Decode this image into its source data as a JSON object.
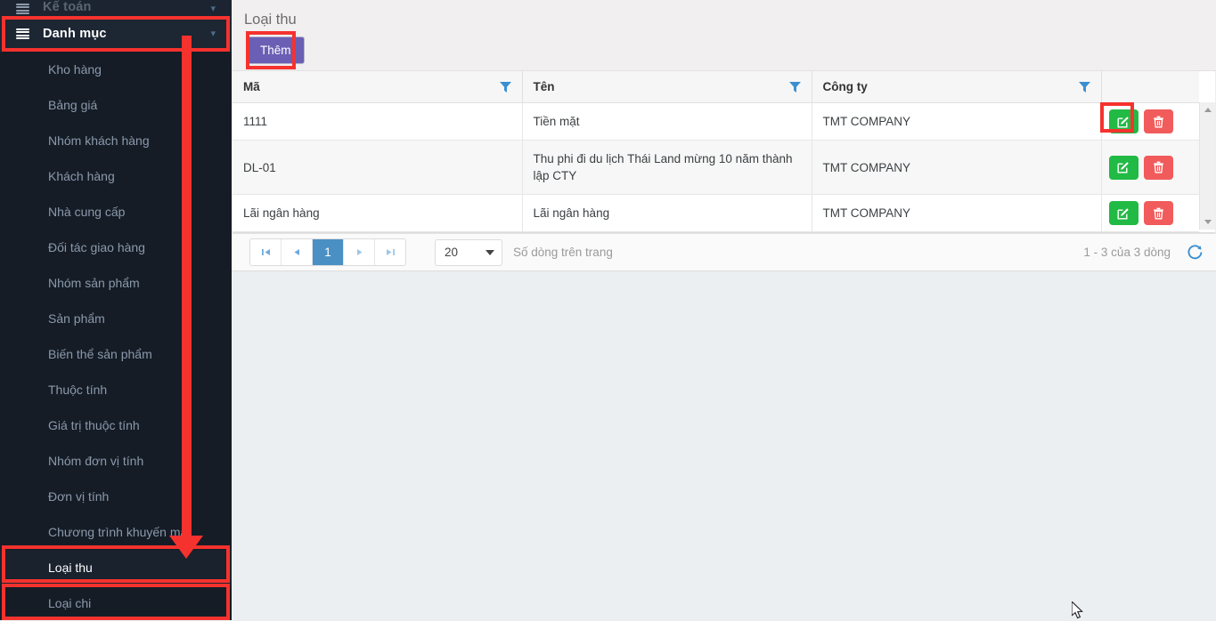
{
  "sidebar": {
    "group_partial": {
      "label": "Kế toán",
      "icon": "list-icon",
      "chevron": "chevron-down-icon"
    },
    "group_active": {
      "label": "Danh mục",
      "icon": "list-icon",
      "chevron": "chevron-down-icon"
    },
    "items": [
      {
        "label": "Kho hàng",
        "active": false
      },
      {
        "label": "Bảng giá",
        "active": false
      },
      {
        "label": "Nhóm khách hàng",
        "active": false
      },
      {
        "label": "Khách hàng",
        "active": false
      },
      {
        "label": "Nhà cung cấp",
        "active": false
      },
      {
        "label": "Đối tác giao hàng",
        "active": false
      },
      {
        "label": "Nhóm sản phẩm",
        "active": false
      },
      {
        "label": "Sản phẩm",
        "active": false
      },
      {
        "label": "Biến thể sản phẩm",
        "active": false
      },
      {
        "label": "Thuộc tính",
        "active": false
      },
      {
        "label": "Giá trị thuộc tính",
        "active": false
      },
      {
        "label": "Nhóm đơn vị tính",
        "active": false
      },
      {
        "label": "Đơn vị tính",
        "active": false
      },
      {
        "label": "Chương trình khuyến mại",
        "active": false
      },
      {
        "label": "Loại thu",
        "active": true
      },
      {
        "label": "Loại chi",
        "active": false
      }
    ]
  },
  "header": {
    "title": "Loại thu",
    "add_label": "Thêm"
  },
  "table": {
    "columns": [
      {
        "label": "Mã",
        "filter_icon": "filter-icon"
      },
      {
        "label": "Tên",
        "filter_icon": "filter-icon"
      },
      {
        "label": "Công ty",
        "filter_icon": "filter-icon"
      },
      {
        "label": "",
        "filter_icon": ""
      }
    ],
    "rows": [
      {
        "ma": "1111",
        "ten": "Tiền mặt",
        "congty": "TMT COMPANY",
        "edit_icon": "edit-icon",
        "delete_icon": "trash-icon"
      },
      {
        "ma": "DL-01",
        "ten": "Thu phi đi du lịch Thái Land mừng 10 năm thành lập CTY",
        "congty": "TMT COMPANY",
        "edit_icon": "edit-icon",
        "delete_icon": "trash-icon"
      },
      {
        "ma": "Lãi ngân hàng",
        "ten": "Lãi ngân hàng",
        "congty": "TMT COMPANY",
        "edit_icon": "edit-icon",
        "delete_icon": "trash-icon"
      }
    ]
  },
  "pager": {
    "first_icon": "first-page-icon",
    "prev_icon": "prev-page-icon",
    "current_page": "1",
    "next_icon": "next-page-icon",
    "last_icon": "last-page-icon",
    "page_size": "20",
    "page_size_label": "Số dòng trên trang",
    "count_text": "1 - 3 của 3 dòng",
    "refresh_icon": "refresh-icon"
  },
  "colors": {
    "annotation": "#f5322e",
    "accent_purple": "#6a5fb4",
    "edit_green": "#21ba45",
    "delete_red": "#f25b5b",
    "sidebar_bg": "#151c26",
    "filter_blue": "#3a8fd0"
  }
}
